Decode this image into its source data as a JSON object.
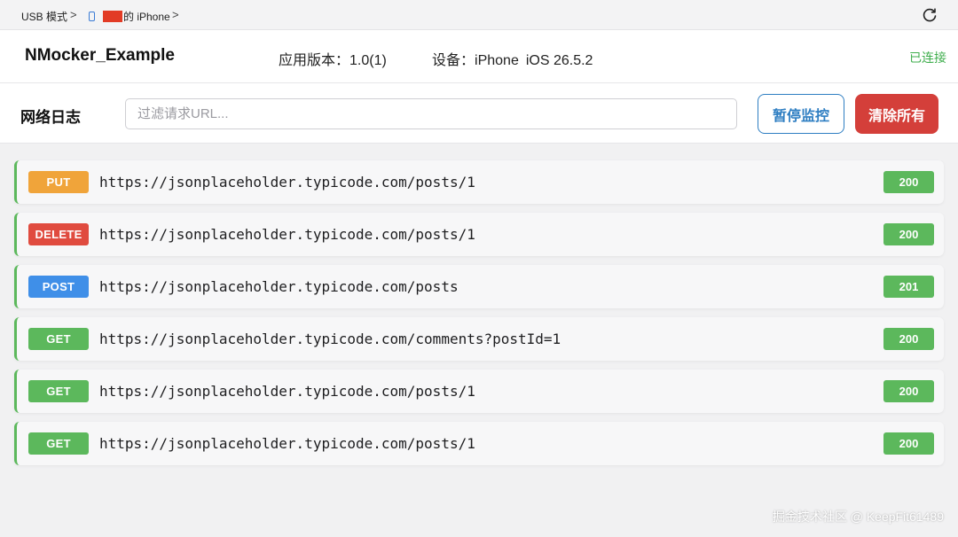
{
  "breadcrumb": {
    "usb_label": "USB 模式",
    "device_label": "的 iPhone",
    "separator": ">"
  },
  "header": {
    "app_name": "NMocker_Example",
    "version_label": "应用版本：",
    "version_value": "1.0(1)",
    "device_label": "设备：",
    "device_model": "iPhone",
    "device_os": "iOS 26.5.2",
    "connection_status": "已连接"
  },
  "toolbar": {
    "title": "网络日志",
    "filter_placeholder": "过滤请求URL...",
    "pause_label": "暂停监控",
    "clear_label": "清除所有"
  },
  "logs": [
    {
      "method": "PUT",
      "url": "https://jsonplaceholder.typicode.com/posts/1",
      "status": "200"
    },
    {
      "method": "DELETE",
      "url": "https://jsonplaceholder.typicode.com/posts/1",
      "status": "200"
    },
    {
      "method": "POST",
      "url": "https://jsonplaceholder.typicode.com/posts",
      "status": "201"
    },
    {
      "method": "GET",
      "url": "https://jsonplaceholder.typicode.com/comments?postId=1",
      "status": "200"
    },
    {
      "method": "GET",
      "url": "https://jsonplaceholder.typicode.com/posts/1",
      "status": "200"
    },
    {
      "method": "GET",
      "url": "https://jsonplaceholder.typicode.com/posts/1",
      "status": "200"
    }
  ],
  "watermark": "掘金技术社区 @ KeepFit61489",
  "colors": {
    "accent": "#2e7ec2",
    "danger": "#d43f3a",
    "success": "#5cb85c",
    "put": "#f0a43a",
    "delete": "#e04b3f",
    "post": "#3f8fe8",
    "get": "#5cb85c"
  },
  "icons": {
    "device": "phone-icon",
    "refresh": "refresh-icon"
  }
}
